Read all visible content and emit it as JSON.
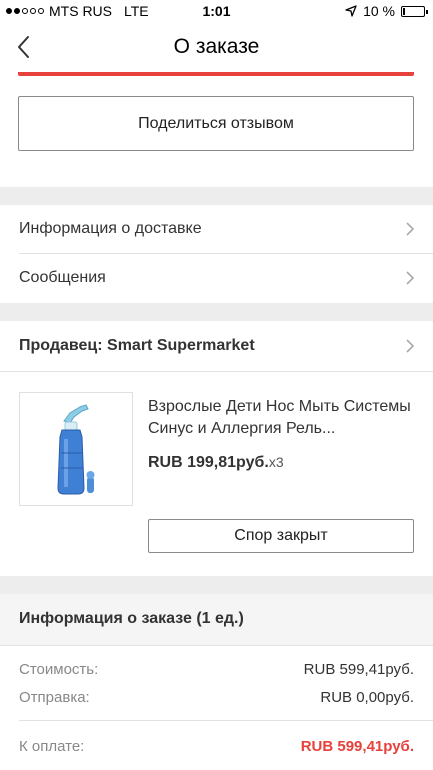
{
  "status_bar": {
    "carrier": "MTS RUS",
    "network": "LTE",
    "time": "1:01",
    "battery_text": "10 %",
    "battery_level": 0.1,
    "signal_bars_filled": 2,
    "signal_bars_total": 5
  },
  "nav": {
    "title": "О заказе"
  },
  "actions": {
    "share_review": "Поделиться отзывом"
  },
  "menu": {
    "delivery_info": "Информация о доставке",
    "messages": "Сообщения"
  },
  "seller": {
    "label": "Продавец: Smart Supermarket"
  },
  "product": {
    "title": "Взрослые Дети Нос Мыть Системы Синус и Аллергия Рель...",
    "price": "RUB 199,81руб.",
    "qty": "x3",
    "dispute_button": "Спор закрыт"
  },
  "order_info": {
    "header": "Информация о заказе (1 ед.)",
    "cost_label": "Стоимость:",
    "cost_value": "RUB 599,41руб.",
    "shipping_label": "Отправка:",
    "shipping_value": "RUB 0,00руб.",
    "total_label": "К оплате:",
    "total_value": "RUB 599,41руб."
  },
  "colors": {
    "accent": "#e8403a",
    "band": "#ededed"
  },
  "icons": [
    "back-chevron-icon",
    "location-arrow-icon",
    "chevron-right-icon"
  ]
}
